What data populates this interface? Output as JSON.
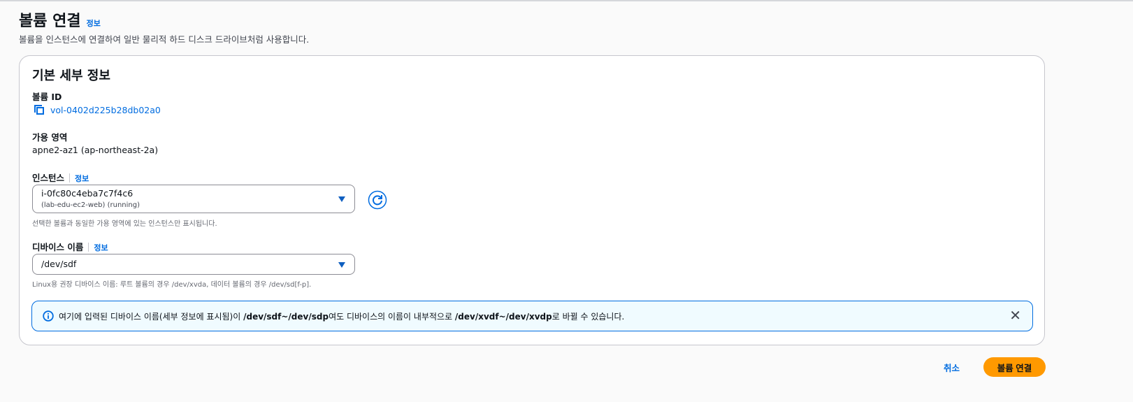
{
  "page": {
    "title": "볼륨 연결",
    "info": "정보",
    "description": "볼륨을 인스턴스에 연결하여 일반 물리적 하드 디스크 드라이브처럼 사용합니다."
  },
  "details": {
    "heading": "기본 세부 정보",
    "volume_id_label": "볼륨 ID",
    "volume_id": "vol-0402d225b28db02a0",
    "az_label": "가용 영역",
    "az_value": "apne2-az1 (ap-northeast-2a)",
    "instance_label": "인스턴스",
    "instance_info": "정보",
    "instance_value": "i-0fc80c4eba7c7f4c6",
    "instance_sub": "(lab-edu-ec2-web) (running)",
    "instance_hint": "선택한 볼륨과 동일한 가용 영역에 있는 인스턴스만 표시됩니다.",
    "device_label": "디바이스 이름",
    "device_info": "정보",
    "device_value": "/dev/sdf",
    "device_hint": "Linux용 권장 디바이스 이름: 루트 볼륨의 경우 /dev/xvda, 데이터 볼륨의 경우 /dev/sd[f-p]."
  },
  "alert": {
    "t1": "여기에 입력된 디바이스 이름(세부 정보에 표시됨)이 ",
    "b1": "/dev/sdf~/dev/sdp",
    "t2": "여도 디바이스의 이름이 내부적으로 ",
    "b2": "/dev/xvdf~/dev/xvdp",
    "t3": "로 바뀔 수 있습니다."
  },
  "actions": {
    "cancel": "취소",
    "submit": "볼륨 연결"
  },
  "colors": {
    "accent": "#006ce0",
    "primary": "#ff9900"
  }
}
